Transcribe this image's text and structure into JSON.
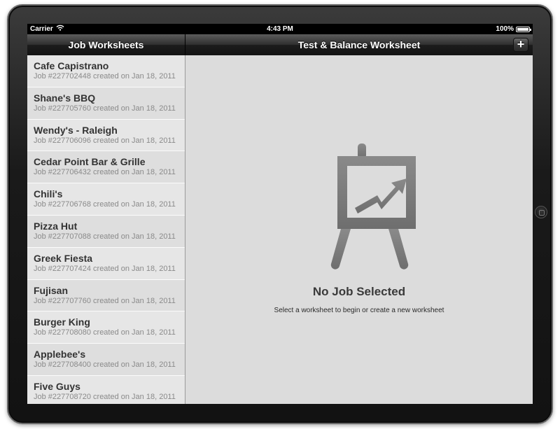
{
  "status_bar": {
    "carrier": "Carrier",
    "time": "4:43 PM",
    "battery": "100%"
  },
  "master": {
    "title": "Job Worksheets",
    "items": [
      {
        "title": "Cafe Capistrano",
        "subtitle": "Job #227702448 created on Jan 18, 2011"
      },
      {
        "title": "Shane's BBQ",
        "subtitle": "Job #227705760 created on Jan 18, 2011"
      },
      {
        "title": "Wendy's - Raleigh",
        "subtitle": "Job #227706096 created on Jan 18, 2011"
      },
      {
        "title": "Cedar Point Bar & Grille",
        "subtitle": "Job #227706432 created on Jan 18, 2011"
      },
      {
        "title": "Chili's",
        "subtitle": "Job #227706768 created on Jan 18, 2011"
      },
      {
        "title": "Pizza Hut",
        "subtitle": "Job #227707088 created on Jan 18, 2011"
      },
      {
        "title": "Greek Fiesta",
        "subtitle": "Job #227707424 created on Jan 18, 2011"
      },
      {
        "title": "Fujisan",
        "subtitle": "Job #227707760 created on Jan 18, 2011"
      },
      {
        "title": "Burger King",
        "subtitle": "Job #227708080 created on Jan 18, 2011"
      },
      {
        "title": "Applebee's",
        "subtitle": "Job #227708400 created on Jan 18, 2011"
      },
      {
        "title": "Five Guys",
        "subtitle": "Job #227708720 created on Jan 18, 2011"
      }
    ]
  },
  "detail": {
    "title": "Test & Balance Worksheet",
    "add_label": "+",
    "empty_title": "No Job Selected",
    "empty_subtitle": "Select a worksheet to begin or create a new worksheet",
    "icon": "presentation-easel-icon"
  },
  "colors": {
    "bar_dark": "#1c1c1c",
    "list_bg": "#e6e6e6",
    "detail_bg": "#dcdcdc",
    "icon_gray": "#7a7a7a"
  }
}
